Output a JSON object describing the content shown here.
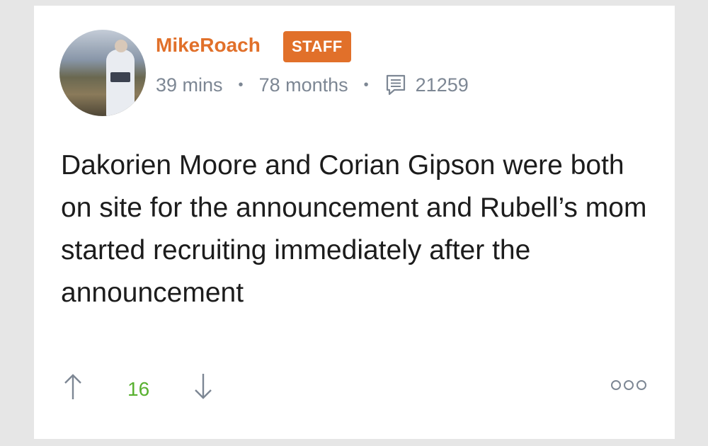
{
  "post": {
    "author": "MikeRoach",
    "badge": "STAFF",
    "time_ago": "39 mins",
    "member_since": "78 months",
    "post_count": "21259",
    "body": "Dakorien Moore and Corian Gipson were both on site for the announcement and Rubell’s mom started recruiting immediately after the announcement",
    "score": "16",
    "icons": {
      "upvote": "arrow-up-icon",
      "downvote": "arrow-down-icon",
      "comments": "comment-icon",
      "more": "more-options-icon"
    },
    "colors": {
      "accent": "#e1702a",
      "score": "#59b130",
      "meta": "#7d8794"
    }
  }
}
